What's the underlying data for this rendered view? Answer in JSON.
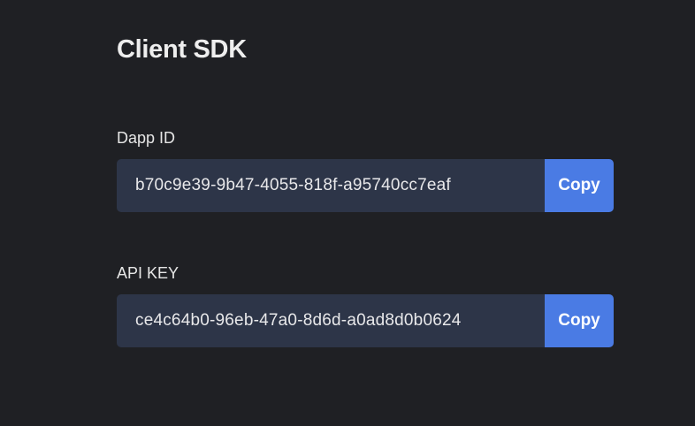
{
  "section": {
    "title": "Client SDK"
  },
  "fields": {
    "dapp_id": {
      "label": "Dapp ID",
      "value": "b70c9e39-9b47-4055-818f-a95740cc7eaf",
      "copy_label": "Copy"
    },
    "api_key": {
      "label": "API KEY",
      "value": "ce4c64b0-96eb-47a0-8d6d-a0ad8d0b0624",
      "copy_label": "Copy"
    }
  },
  "colors": {
    "background": "#1f2024",
    "field_background": "#2d3548",
    "accent": "#4a7be4",
    "text": "#e8e8ea"
  }
}
